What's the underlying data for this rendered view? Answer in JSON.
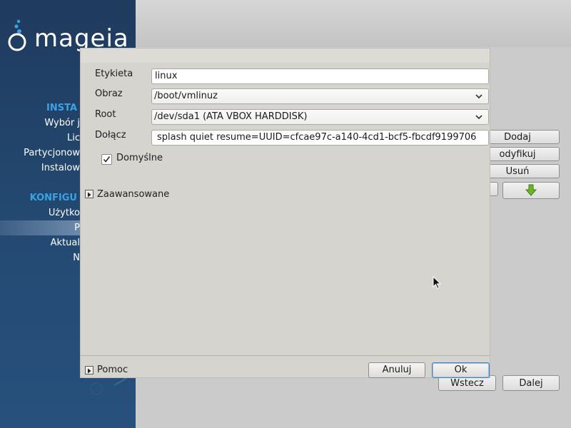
{
  "sidebar": {
    "logo_text": "mageia",
    "sections": [
      "INSTA",
      "KONFIGU"
    ],
    "items": [
      "Wybór j",
      "Lic",
      "Partycjonow",
      "Instalow",
      "Użytko",
      "P",
      "Aktual",
      "N"
    ]
  },
  "background": {
    "right_buttons": [
      "Dodaj",
      "odyfikuj",
      "Usuń"
    ],
    "nav_buttons": {
      "back": "Wstecz",
      "next": "Dalej"
    }
  },
  "dialog": {
    "fields": {
      "label_label": "Etykieta",
      "label_value": "linux",
      "image_label": "Obraz",
      "image_value": "/boot/vmlinuz",
      "root_label": "Root",
      "root_value": "/dev/sda1 (ATA VBOX HARDDISK)",
      "append_label": "Dołącz",
      "append_value": "splash quiet resume=UUID=cfcae97c-a140-4cd1-bcf5-fbcdf9199706"
    },
    "default_checkbox": {
      "label": "Domyślne",
      "checked": true
    },
    "advanced_label": "Zaawansowane",
    "help_label": "Pomoc",
    "cancel_label": "Anuluj",
    "ok_label": "Ok"
  },
  "colors": {
    "sidebar_bg": "#244a73",
    "sidebar_section": "#3aa3e3",
    "arrow_green": "#6ab82a"
  }
}
